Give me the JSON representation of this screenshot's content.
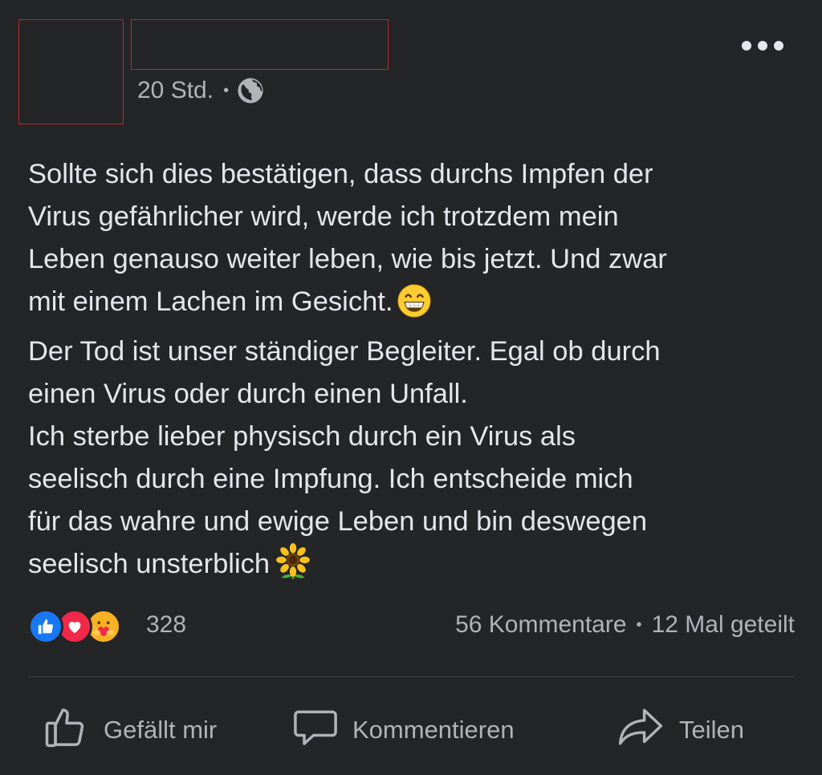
{
  "post": {
    "timestamp": "20 Std.",
    "separator": "•",
    "audience_icon": "globe-icon",
    "more_icon": "more-options-icon",
    "text_lines": [
      "Sollte sich dies bestätigen, dass durchs Impfen der",
      "Virus gefährlicher wird, werde ich trotzdem mein",
      "Leben genauso weiter leben, wie bis jetzt. Und zwar",
      "mit einem Lachen im Gesicht.",
      "Der Tod ist unser ständiger Begleiter. Egal ob durch",
      "einen Virus oder durch einen Unfall.",
      "Ich sterbe lieber physisch durch ein Virus als",
      "seelisch durch eine Impfung. Ich entscheide mich",
      "für das wahre und ewige Leben und bin deswegen",
      "seelisch unsterblich"
    ],
    "emoji_1": "grinning-face-emoji",
    "emoji_2": "sunflower-emoji"
  },
  "reactions": {
    "icons": [
      "like-reaction-icon",
      "love-reaction-icon",
      "care-reaction-icon"
    ],
    "count": "328",
    "comments": "56 Kommentare",
    "separator": "•",
    "shares": "12 Mal geteilt"
  },
  "actions": {
    "like_label": "Gefällt mir",
    "comment_label": "Kommentieren",
    "share_label": "Teilen"
  },
  "colors": {
    "background": "#242526",
    "text_primary": "#e4e6eb",
    "text_secondary": "#b0b3b8",
    "like_blue": "#1877f2",
    "love_red": "#f0284a",
    "care_yellow": "#f7b125",
    "redaction_red": "#c0242a"
  }
}
